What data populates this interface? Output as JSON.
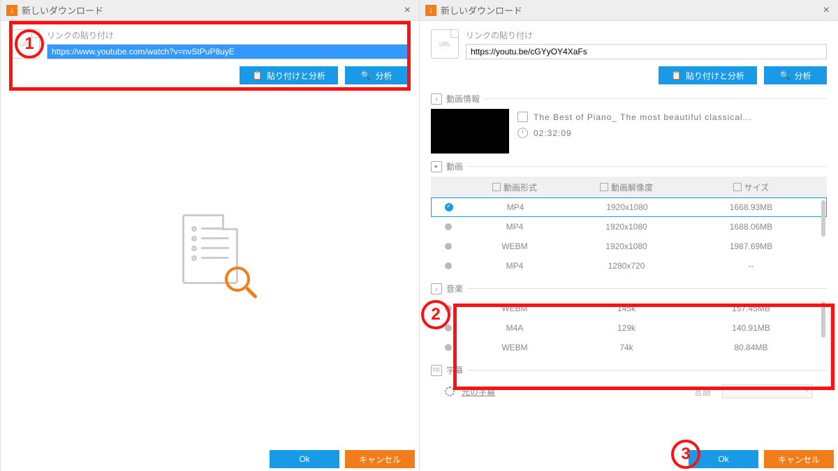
{
  "window_title": "新しいダウンロード",
  "badges": {
    "one": "1",
    "two": "2",
    "three": "3"
  },
  "left": {
    "link_label": "リンクの貼り付け",
    "url_value": "https://www.youtube.com/watch?v=nvStPuP8uyE",
    "url_icon_text": "URL",
    "btn_paste_analyze": "貼り付けと分析",
    "btn_analyze": "分析",
    "btn_ok": "Ok",
    "btn_cancel": "キャンセル"
  },
  "right": {
    "link_label": "リンクの貼り付け",
    "url_value": "https://youtu.be/cGYyOY4XaFs",
    "url_icon_text": "URL",
    "btn_paste_analyze": "貼り付けと分析",
    "btn_analyze": "分析",
    "section_info": "動画情報",
    "video_title": "The Best of Piano_ The most beautiful classical...",
    "duration": "02:32:09",
    "section_video": "動画",
    "col_format": "動画形式",
    "col_res": "動画解像度",
    "col_size": "サイズ",
    "video_rows": [
      {
        "selected": true,
        "format": "MP4",
        "res": "1920x1080",
        "size": "1668.93MB"
      },
      {
        "selected": false,
        "format": "MP4",
        "res": "1920x1080",
        "size": "1688.06MB"
      },
      {
        "selected": false,
        "format": "WEBM",
        "res": "1920x1080",
        "size": "1987.69MB"
      },
      {
        "selected": false,
        "format": "MP4",
        "res": "1280x720",
        "size": "--"
      }
    ],
    "section_audio": "音楽",
    "audio_rows": [
      {
        "format": "WEBM",
        "res": "145k",
        "size": "157.45MB"
      },
      {
        "format": "M4A",
        "res": "129k",
        "size": "140.91MB"
      },
      {
        "format": "WEBM",
        "res": "74k",
        "size": "80.84MB"
      }
    ],
    "section_subs": "字幕",
    "subs_orig": "元の字幕",
    "subs_lang_label": "言語",
    "btn_ok": "Ok",
    "btn_cancel": "キャンセル"
  }
}
